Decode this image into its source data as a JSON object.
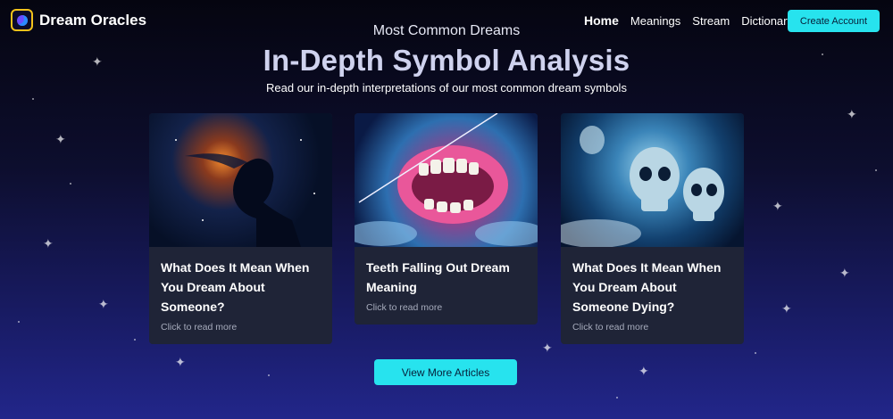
{
  "header": {
    "brand": "Dream Oracles",
    "nav": [
      {
        "label": "Home",
        "active": true
      },
      {
        "label": "Meanings",
        "active": false
      },
      {
        "label": "Stream",
        "active": false
      },
      {
        "label": "Dictionary",
        "active": false
      }
    ],
    "cta_label": "Create Account"
  },
  "hero": {
    "eyebrow": "Most Common Dreams",
    "title": "In-Depth Symbol Analysis",
    "subtitle": "Read our in-depth interpretations of our most common dream symbols"
  },
  "cards": [
    {
      "title": "What Does It Mean When You Dream About Someone?",
      "link": "Click to read more",
      "image": "woman-silhouette-nebula"
    },
    {
      "title": "Teeth Falling Out Dream Meaning",
      "link": "Click to read more",
      "image": "teeth-in-clouds"
    },
    {
      "title": "What Does It Mean When You Dream About Someone Dying?",
      "link": "Click to read more",
      "image": "skulls-in-clouds"
    }
  ],
  "view_more_label": "View More Articles",
  "colors": {
    "accent": "#27e3ee",
    "card_bg": "#1f2437",
    "logo_border": "#f2c21b"
  }
}
